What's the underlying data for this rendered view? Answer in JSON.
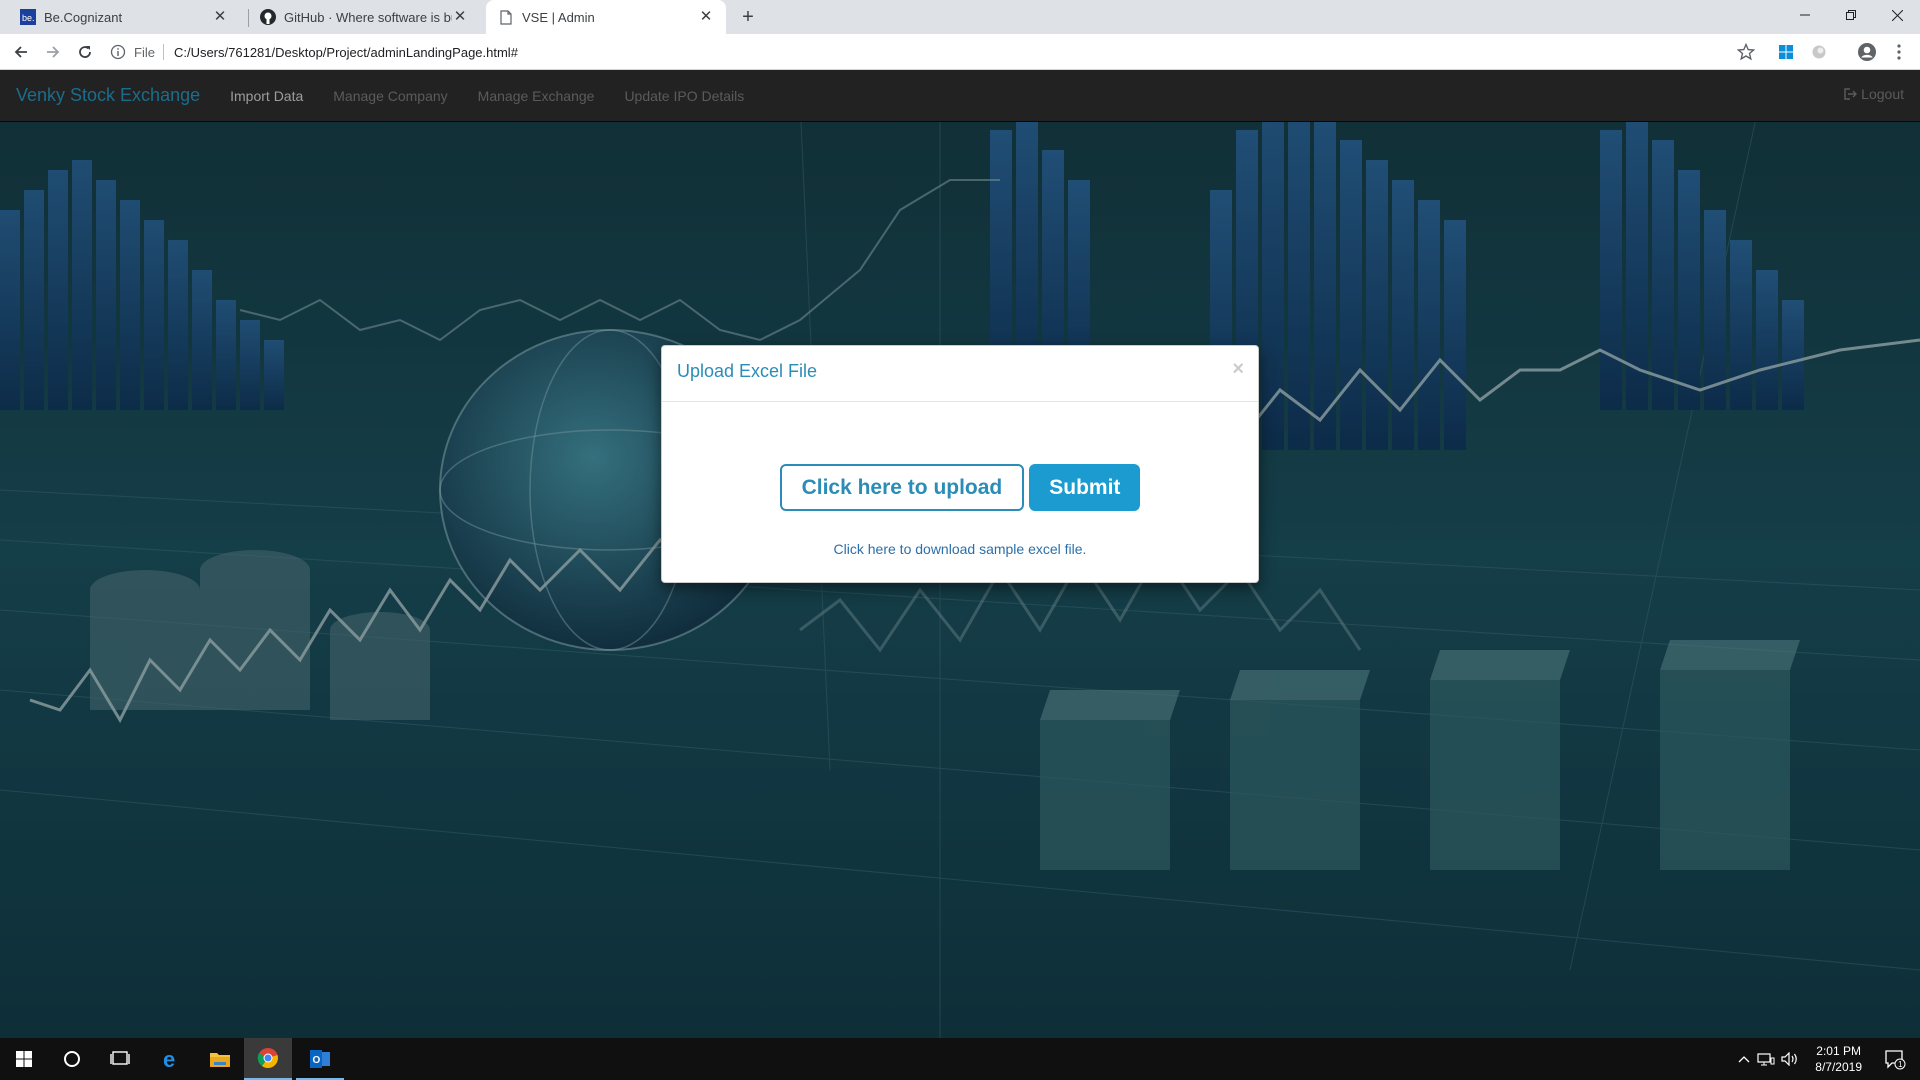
{
  "browser": {
    "tabs": [
      {
        "title": "Be.Cognizant",
        "icon": "be-cognizant-icon",
        "active": false
      },
      {
        "title": "GitHub · Where software is built",
        "icon": "github-icon",
        "active": false
      },
      {
        "title": "VSE | Admin",
        "icon": "page-icon",
        "active": true
      }
    ],
    "address": {
      "scheme": "File",
      "url": "C:/Users/761281/Desktop/Project/adminLandingPage.html#"
    }
  },
  "navbar": {
    "brand": "Venky Stock Exchange",
    "links": [
      "Import Data",
      "Manage Company",
      "Manage Exchange",
      "Update IPO Details"
    ],
    "logout": "Logout"
  },
  "modal": {
    "title": "Upload Excel File",
    "close": "×",
    "upload_button": "Click here to upload",
    "submit_button": "Submit",
    "download_link": "Click here to download sample excel file."
  },
  "taskbar": {
    "time": "2:01 PM",
    "date": "8/7/2019",
    "notification_count": "1"
  },
  "colors": {
    "brand": "#1b6d8c",
    "modal_title": "#2b8cb8",
    "submit_bg": "#1c9bd1",
    "navbar_bg": "#222222"
  }
}
